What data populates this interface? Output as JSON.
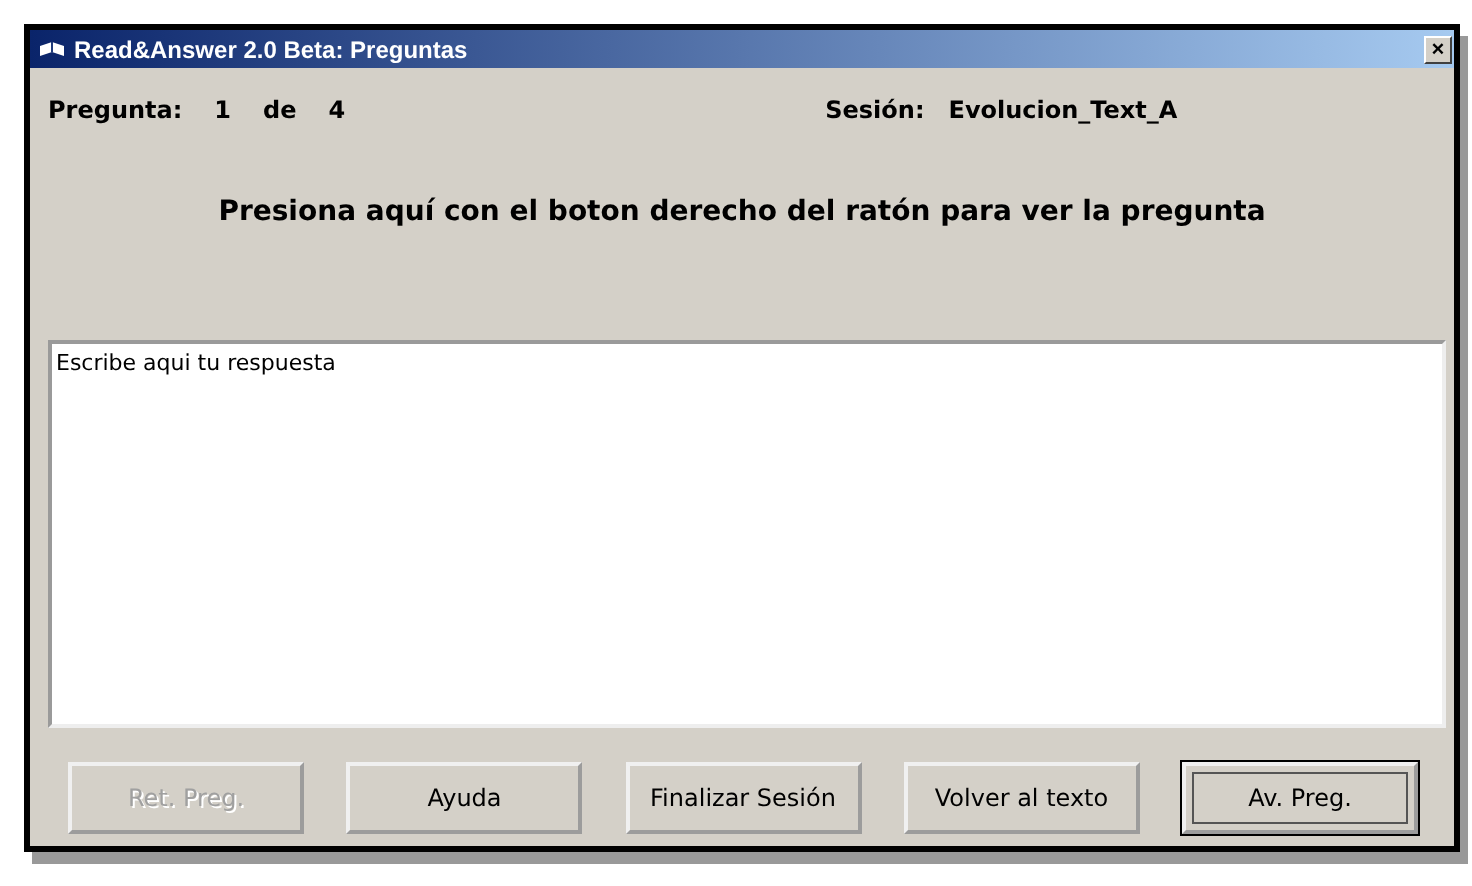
{
  "window": {
    "title": "Read&Answer 2.0 Beta: Preguntas",
    "close": "×"
  },
  "info": {
    "question_label": "Pregunta:",
    "question_number": "1",
    "of_label": "de",
    "question_total": "4",
    "session_label": "Sesión:",
    "session_name": "Evolucion_Text_A"
  },
  "prompt": "Presiona aquí con el boton derecho del ratón para ver la pregunta",
  "answer": {
    "value": "Escribe aqui tu respuesta"
  },
  "buttons": [
    {
      "label": "Ret. Preg.",
      "disabled": true,
      "default": false
    },
    {
      "label": "Ayuda",
      "disabled": false,
      "default": false
    },
    {
      "label": "Finalizar Sesión",
      "disabled": false,
      "default": false
    },
    {
      "label": "Volver al texto",
      "disabled": false,
      "default": false
    },
    {
      "label": "Av. Preg.",
      "disabled": false,
      "default": true
    }
  ]
}
